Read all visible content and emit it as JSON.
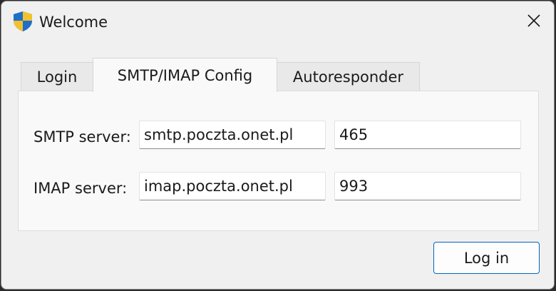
{
  "window": {
    "title": "Welcome",
    "icon": "uac-shield-icon",
    "close_icon": "close-icon"
  },
  "tabs": [
    {
      "label": "Login",
      "active": false
    },
    {
      "label": "SMTP/IMAP Config",
      "active": true
    },
    {
      "label": "Autoresponder",
      "active": false
    }
  ],
  "form": {
    "smtp_label": "SMTP server:",
    "smtp_host": "smtp.poczta.onet.pl",
    "smtp_port": "465",
    "imap_label": "IMAP server:",
    "imap_host": "imap.poczta.onet.pl",
    "imap_port": "993"
  },
  "actions": {
    "login_label": "Log in"
  },
  "colors": {
    "accent": "#0067c0",
    "window_bg": "#f0f0f0",
    "panel_bg": "#f9f9f9"
  }
}
